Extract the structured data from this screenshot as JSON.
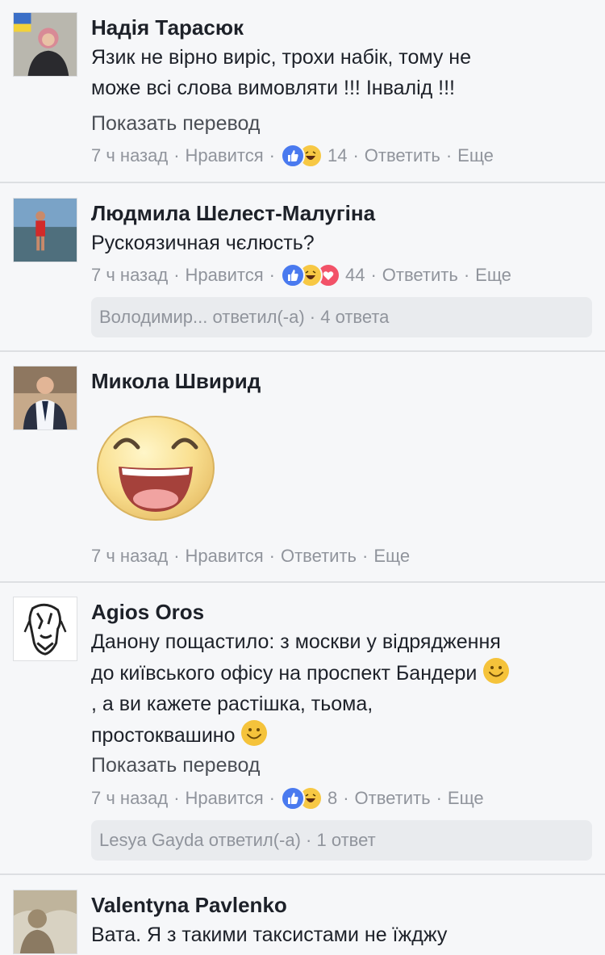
{
  "comments": [
    {
      "name": "Надія Тарасюк",
      "text_lines": [
        "Язик не вірно виріс, трохи набік, тому не",
        "може всі слова вимовляти !!! Інвалід !!!"
      ],
      "translate": "Показать перевод",
      "time": "7 ч назад",
      "like": "Нравится",
      "reactions": [
        "like",
        "haha"
      ],
      "count": "14",
      "reply": "Ответить",
      "more": "Еще"
    },
    {
      "name": "Людмила Шелест-Малугіна",
      "text_lines": [
        "Рускоязичная чєлюсть?"
      ],
      "time": "7 ч назад",
      "like": "Нравится",
      "reactions": [
        "like",
        "haha",
        "love"
      ],
      "count": "44",
      "reply": "Ответить",
      "more": "Еще",
      "replies": "Володимир... ответил(-а) · 4 ответа"
    },
    {
      "name": "Микола Швирид",
      "sticker": "laughing-face-sticker",
      "time": "7 ч назад",
      "like": "Нравится",
      "reply": "Ответить",
      "more": "Еще"
    },
    {
      "name": "Agios Oros",
      "text_lines": [
        "Данону пощастило: з москви у відрядження",
        "до київського офісу на проспект Бандери",
        ", а ви кажете растішка, тьома,",
        "простоквашино"
      ],
      "translate": "Показать перевод",
      "time": "7 ч назад",
      "like": "Нравится",
      "reactions": [
        "like",
        "haha"
      ],
      "count": "8",
      "reply": "Ответить",
      "more": "Еще",
      "replies": "Lesya Gayda ответил(-а) · 1 ответ"
    },
    {
      "name": "Valentyna Pavlenko",
      "text_lines": [
        "Вата. Я з такими таксистами не їжджу"
      ]
    }
  ],
  "sep": "·",
  "colors": {
    "background": "#f6f7f9",
    "meta": "#90949c",
    "like": "#4a7aef",
    "haha": "#f7c844",
    "love": "#f25268"
  }
}
